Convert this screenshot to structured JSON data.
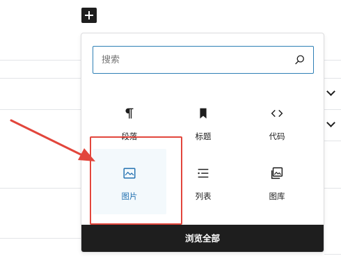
{
  "colors": {
    "accent": "#2271b1",
    "annotation": "#e2463c",
    "dark": "#1e1e1e"
  },
  "inserter": {
    "toggle_icon": "plus-icon"
  },
  "search": {
    "placeholder": "搜索",
    "value": "",
    "icon": "search-icon"
  },
  "blocks": [
    {
      "label": "段落",
      "icon": "paragraph-icon",
      "selected": false
    },
    {
      "label": "标题",
      "icon": "bookmark-icon",
      "selected": false
    },
    {
      "label": "代码",
      "icon": "code-icon",
      "selected": false
    },
    {
      "label": "图片",
      "icon": "image-icon",
      "selected": true
    },
    {
      "label": "列表",
      "icon": "list-icon",
      "selected": false
    },
    {
      "label": "图库",
      "icon": "gallery-icon",
      "selected": false
    }
  ],
  "browse_all_label": "浏览全部",
  "annotation": {
    "type": "red arrow pointing to highlighted 图片 block"
  }
}
